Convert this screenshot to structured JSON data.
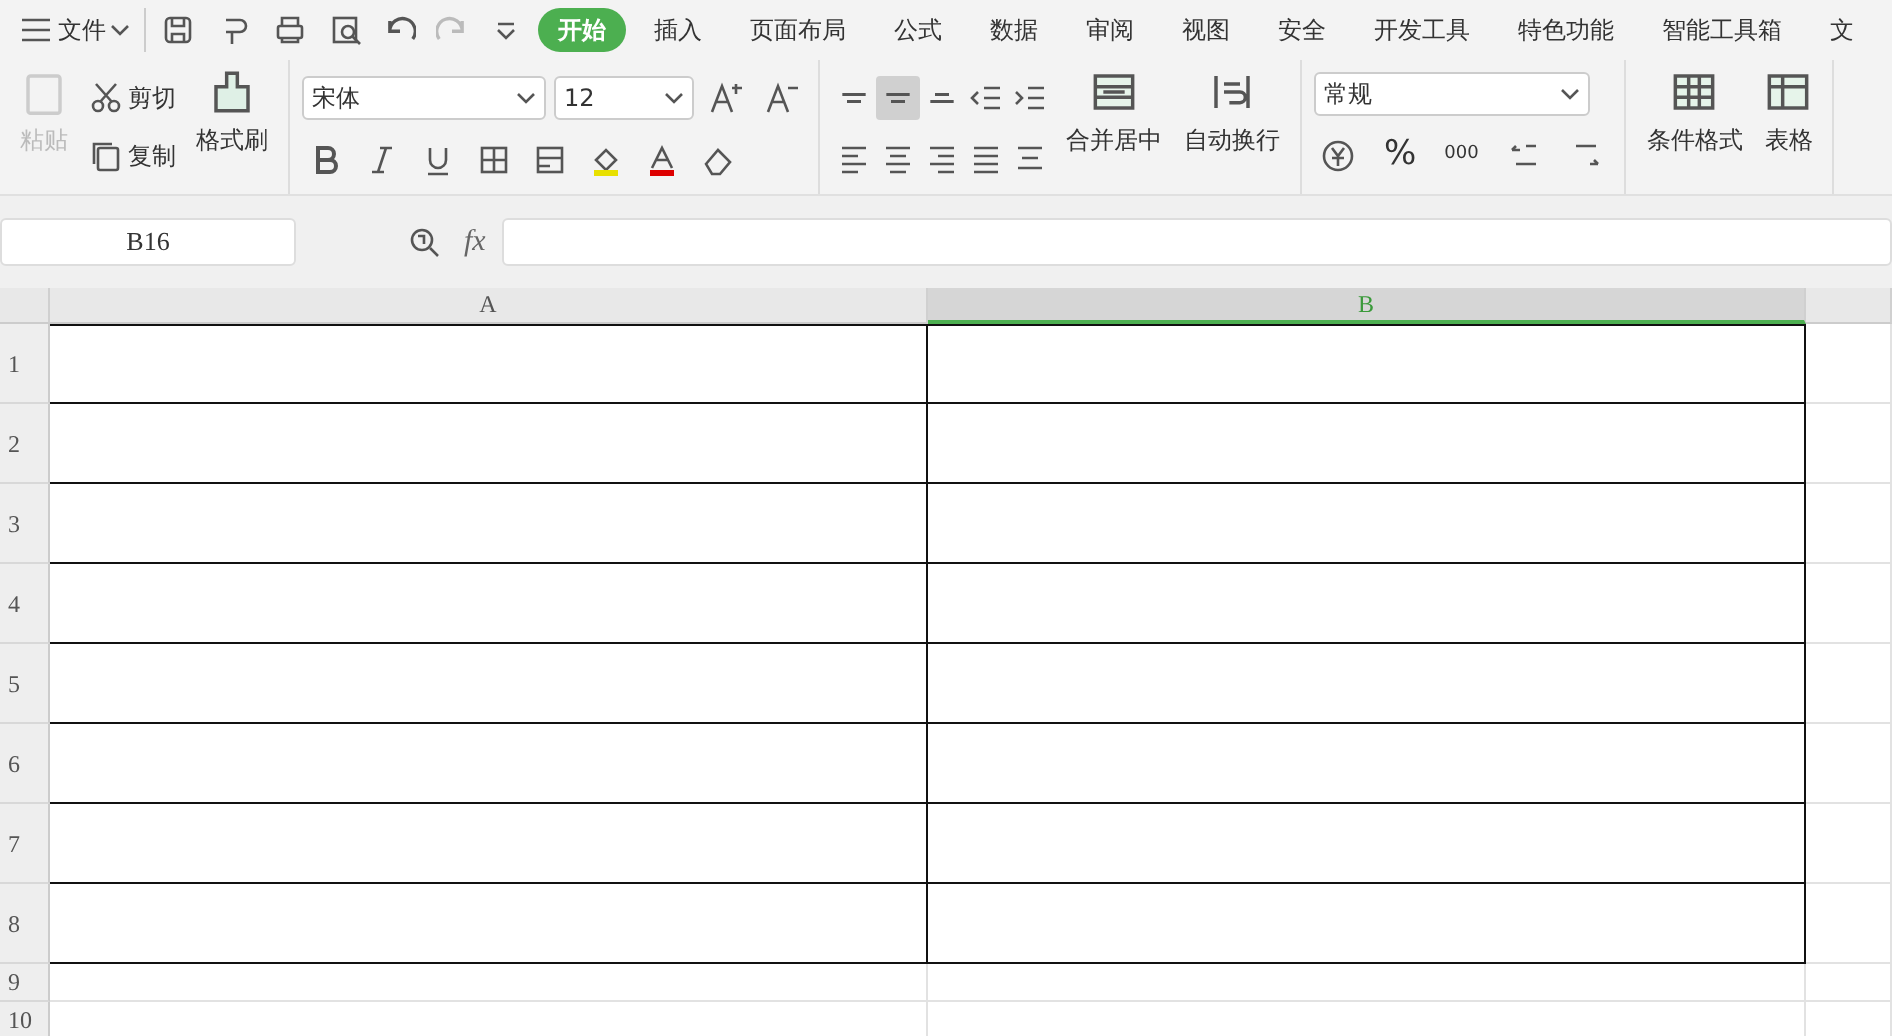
{
  "menu": {
    "file_label": "文件",
    "tabs": [
      {
        "label": "开始",
        "selected": true
      },
      {
        "label": "插入",
        "selected": false
      },
      {
        "label": "页面布局",
        "selected": false
      },
      {
        "label": "公式",
        "selected": false
      },
      {
        "label": "数据",
        "selected": false
      },
      {
        "label": "审阅",
        "selected": false
      },
      {
        "label": "视图",
        "selected": false
      },
      {
        "label": "安全",
        "selected": false
      },
      {
        "label": "开发工具",
        "selected": false
      },
      {
        "label": "特色功能",
        "selected": false
      },
      {
        "label": "智能工具箱",
        "selected": false
      },
      {
        "label": "文",
        "selected": false
      }
    ]
  },
  "ribbon": {
    "paste": {
      "label": "粘贴",
      "disabled": true
    },
    "cut": "剪切",
    "copy": "复制",
    "format_painter": "格式刷",
    "font_name": "宋体",
    "font_size": "12",
    "align_top": [
      {
        "kind": "top",
        "selected": false
      },
      {
        "kind": "middle",
        "selected": true
      },
      {
        "kind": "bottom",
        "selected": false
      },
      {
        "kind": "outdent",
        "selected": false
      },
      {
        "kind": "indent",
        "selected": false
      }
    ],
    "merge": "合并居中",
    "wrap": "自动换行",
    "number_format": "常规",
    "percent": "%",
    "thousands": "000",
    "conditional": "条件格式",
    "table_style": "表格"
  },
  "formula_bar": {
    "name_box": "B16",
    "fx": "fx"
  },
  "sheet": {
    "columns": [
      {
        "label": "A",
        "selected": false
      },
      {
        "label": "B",
        "selected": true
      }
    ],
    "rows": [
      {
        "label": "1",
        "bordered": true
      },
      {
        "label": "2",
        "bordered": true
      },
      {
        "label": "3",
        "bordered": true
      },
      {
        "label": "4",
        "bordered": true
      },
      {
        "label": "5",
        "bordered": true
      },
      {
        "label": "6",
        "bordered": true
      },
      {
        "label": "7",
        "bordered": true
      },
      {
        "label": "8",
        "bordered": true
      },
      {
        "label": "9",
        "bordered": false
      },
      {
        "label": "10",
        "bordered": false
      }
    ]
  }
}
